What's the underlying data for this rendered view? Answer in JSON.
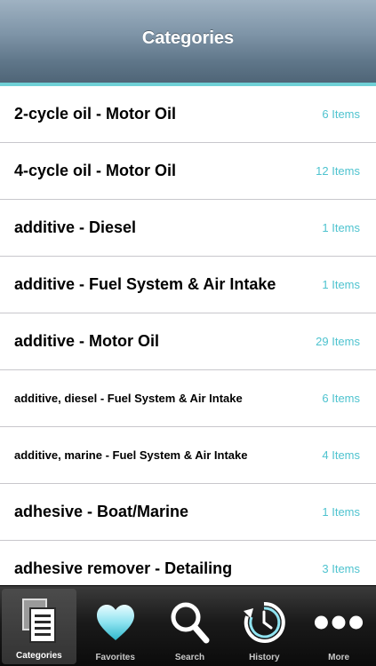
{
  "navbar": {
    "title": "Categories"
  },
  "list": {
    "rows": [
      {
        "title": "2-cycle oil - Motor Oil",
        "count": "6 Items"
      },
      {
        "title": "4-cycle oil - Motor Oil",
        "count": "12 Items"
      },
      {
        "title": "additive - Diesel",
        "count": "1 Items"
      },
      {
        "title": "additive - Fuel System & Air Intake",
        "count": "1 Items"
      },
      {
        "title": "additive - Motor Oil",
        "count": "29 Items"
      },
      {
        "title": "additive, diesel - Fuel System & Air Intake",
        "count": "6 Items"
      },
      {
        "title": "additive, marine - Fuel System & Air Intake",
        "count": "4 Items"
      },
      {
        "title": "adhesive - Boat/Marine",
        "count": "1 Items"
      },
      {
        "title": "adhesive remover - Detailing",
        "count": "3 Items"
      }
    ]
  },
  "tabbar": {
    "tabs": [
      {
        "label": "Categories",
        "icon": "documents-icon",
        "selected": true
      },
      {
        "label": "Favorites",
        "icon": "heart-icon",
        "selected": false
      },
      {
        "label": "Search",
        "icon": "search-icon",
        "selected": false
      },
      {
        "label": "History",
        "icon": "clock-icon",
        "selected": false
      },
      {
        "label": "More",
        "icon": "more-icon",
        "selected": false
      }
    ]
  },
  "colors": {
    "accent": "#4ec3cf",
    "navbar": "#6f8598",
    "separator": "#c8c7cc"
  }
}
